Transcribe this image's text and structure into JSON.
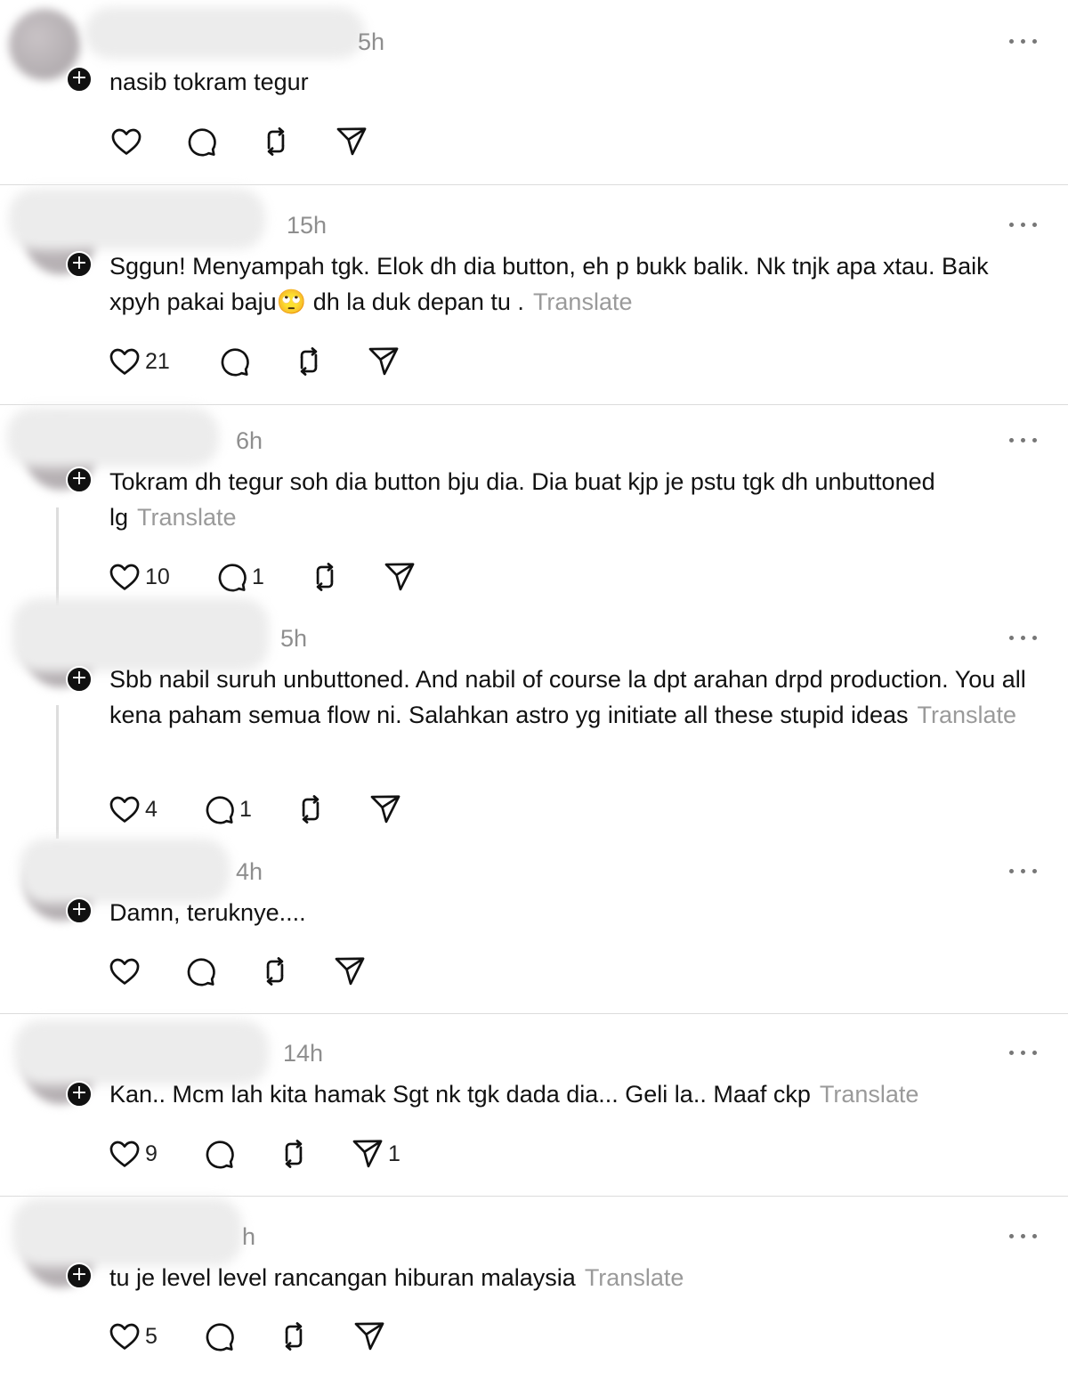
{
  "translate_label": "Translate",
  "posts": [
    {
      "time": "5h",
      "text": "nasib tokram tegur",
      "translate": "",
      "likes": "",
      "replies": "",
      "shares": ""
    },
    {
      "time": "15h",
      "text": "Sggun! Menyampah tgk. Elok dh dia button, eh p bukk balik. Nk tnjk apa xtau. Baik xpyh pakai baju🙄 dh la duk depan tu .",
      "translate": "Translate",
      "likes": "21",
      "replies": "",
      "shares": ""
    },
    {
      "time": "6h",
      "text": "Tokram dh tegur soh dia button bju dia. Dia buat kjp je pstu tgk dh unbuttoned lg",
      "translate": "Translate",
      "likes": "10",
      "replies": "1",
      "shares": ""
    },
    {
      "time": "5h",
      "text": "Sbb nabil suruh unbuttoned. And nabil of course la dpt arahan drpd production. You all kena paham semua flow ni. Salahkan astro yg initiate all these stupid ideas",
      "translate": "Translate",
      "likes": "4",
      "replies": "1",
      "shares": ""
    },
    {
      "time": "4h",
      "text": "Damn, teruknye....",
      "translate": "",
      "likes": "",
      "replies": "",
      "shares": ""
    },
    {
      "time": "14h",
      "text": "Kan.. Mcm lah kita hamak Sgt nk tgk dada dia... Geli la.. Maaf ckp",
      "translate": "Translate",
      "likes": "9",
      "replies": "",
      "shares": "1"
    },
    {
      "time": "h",
      "text": "tu je level level rancangan hiburan malaysia",
      "translate": "Translate",
      "likes": "5",
      "replies": "",
      "shares": ""
    }
  ],
  "icons": {
    "like": "heart-icon",
    "reply": "comment-icon",
    "repost": "repost-icon",
    "share": "send-icon",
    "more": "more-icon",
    "follow": "plus-icon"
  }
}
